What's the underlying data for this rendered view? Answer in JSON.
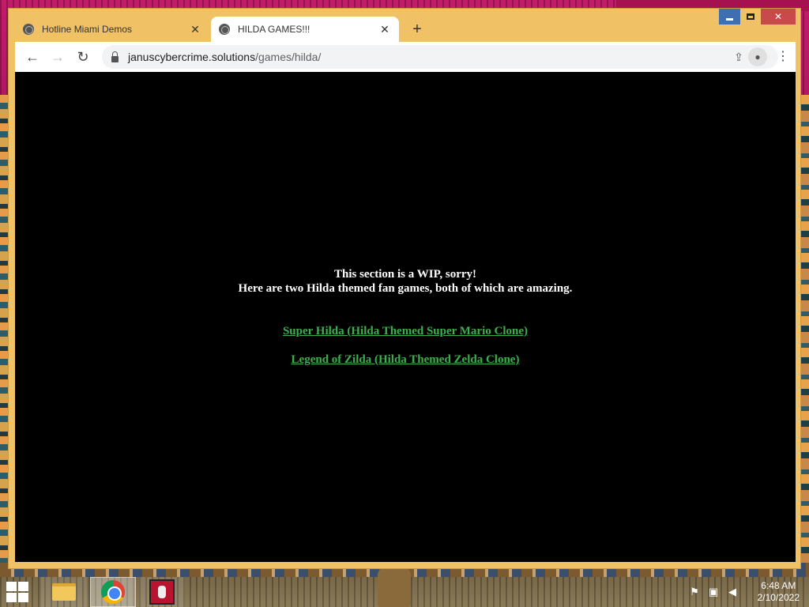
{
  "browser": {
    "tabs": [
      {
        "title": "Hotline Miami Demos",
        "active": false
      },
      {
        "title": "HILDA GAMES!!!",
        "active": true
      }
    ],
    "url_host": "januscybercrime.solutions",
    "url_path": "/games/hilda/",
    "window_controls": {
      "minimize": "minimize-icon",
      "maximize": "maximize-icon",
      "close": "✕"
    }
  },
  "page": {
    "message_line1": "This section is a WIP, sorry!",
    "message_line2": "Here are two Hilda themed fan games, both of which are amazing.",
    "links": [
      {
        "label": "Super Hilda (Hilda Themed Super Mario Clone)"
      },
      {
        "label": "Legend of Zilda (Hilda Themed Zelda Clone)"
      }
    ],
    "link_color": "#3ab14a",
    "background_color": "#000000"
  },
  "taskbar": {
    "apps": [
      "file-explorer-icon",
      "chrome-icon",
      "game-icon"
    ],
    "clock_time": "6:48 AM",
    "clock_date": "2/10/2022"
  }
}
